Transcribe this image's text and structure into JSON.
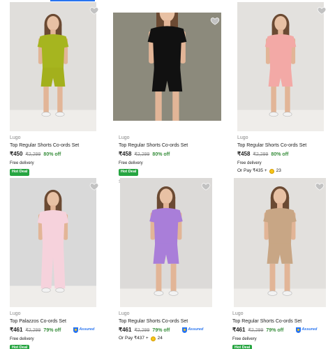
{
  "products": [
    {
      "brand": "Lugo",
      "title": "Top Regular Shorts Co-ords Set",
      "price": "₹450",
      "mrp": "₹2,299",
      "discount": "80% off",
      "delivery": "Free delivery",
      "badge": "Hot Deal",
      "pay": "",
      "coins": "",
      "assured": "",
      "size": "",
      "top_color": "#a6b51f",
      "bottom_color": "#a3b01c",
      "bg_color": "#e0dedb"
    },
    {
      "brand": "Lugo",
      "title": "Top Regular Shorts Co-ords Set",
      "price": "₹458",
      "mrp": "₹2,299",
      "discount": "80% off",
      "delivery": "Free delivery",
      "badge": "Hot Deal",
      "pay": "",
      "coins": "",
      "assured": "",
      "size": "Size M, L",
      "top_color": "#111111",
      "bottom_color": "#111111",
      "bg_color": "#8c8a7c"
    },
    {
      "brand": "Lugo",
      "title": "Top Regular Shorts Co-ords Set",
      "price": "₹458",
      "mrp": "₹2,299",
      "discount": "80% off",
      "delivery": "Free delivery",
      "badge": "",
      "pay": "Or Pay ₹435 +",
      "coins": "23",
      "assured": "",
      "size": "",
      "top_color": "#f3a9a6",
      "bottom_color": "#f3a9a6",
      "bg_color": "#e3e1de"
    },
    {
      "brand": "Lugo",
      "title": "Top Palazzos Co-ords Set",
      "price": "₹461",
      "mrp": "₹2,299",
      "discount": "79% off",
      "delivery": "Free delivery",
      "badge": "Hot Deal",
      "pay": "",
      "coins": "",
      "assured": "Assured",
      "size": "",
      "top_color": "#f6d2dc",
      "bottom_color": "#f6d2dc",
      "bg_color": "#d9d9d9"
    },
    {
      "brand": "Lugo",
      "title": "Top Regular Shorts Co-ords Set",
      "price": "₹461",
      "mrp": "₹2,299",
      "discount": "79% off",
      "delivery": "",
      "badge": "",
      "pay": "Or Pay ₹437 +",
      "coins": "24",
      "assured": "Assured",
      "size": "",
      "top_color": "#a97ed9",
      "bottom_color": "#a97ed9",
      "bg_color": "#dcdad8"
    },
    {
      "brand": "Lugo",
      "title": "Top Regular Shorts Co-ords Set",
      "price": "₹461",
      "mrp": "₹2,299",
      "discount": "79% off",
      "delivery": "Free delivery",
      "badge": "Hot Deal",
      "pay": "",
      "coins": "",
      "assured": "Assured",
      "size": "",
      "top_color": "#c8a685",
      "bottom_color": "#c8a685",
      "bg_color": "#e2e0dd"
    }
  ]
}
